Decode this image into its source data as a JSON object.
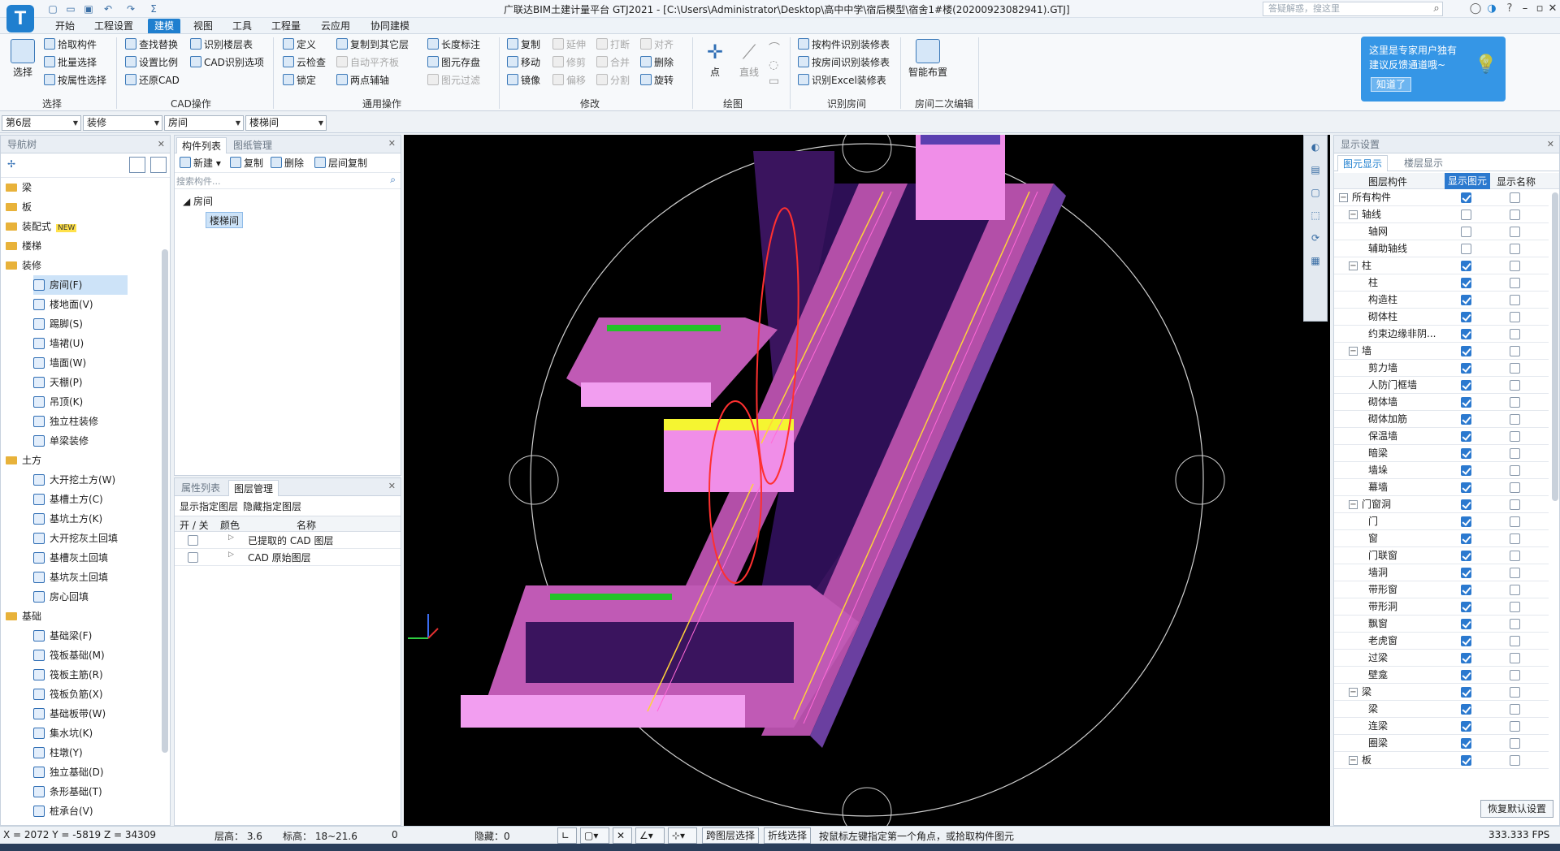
{
  "app": {
    "logo": "T",
    "title": "广联达BIM土建计量平台 GTJ2021 - [C:\\Users\\Administrator\\Desktop\\高中中学\\宿后模型\\宿舍1#楼(20200923082941).GTJ]",
    "search_placeholder": "答疑解惑，搜这里",
    "accent": "#1f7fcf"
  },
  "menu": [
    "开始",
    "工程设置",
    "建模",
    "视图",
    "工具",
    "工程量",
    "云应用",
    "协同建模"
  ],
  "menu_active": "建模",
  "ribbon": {
    "select": {
      "big": "选择",
      "items": [
        "拾取构件",
        "批量选择",
        "按属性选择"
      ],
      "label": "选择"
    },
    "cad": {
      "items": [
        "查找替换",
        "设置比例",
        "还原CAD",
        "识别楼层表",
        "CAD识别选项"
      ],
      "label": "CAD操作"
    },
    "common": {
      "items": [
        "定义",
        "云检查",
        "锁定",
        "复制到其它层",
        "自动平齐板",
        "两点辅轴",
        "长度标注",
        "图元存盘",
        "图元过滤"
      ],
      "label": "通用操作"
    },
    "modify": {
      "items": [
        "复制",
        "移动",
        "镜像",
        "延伸",
        "修剪",
        "偏移",
        "打断",
        "合并",
        "分割",
        "对齐",
        "删除",
        "旋转"
      ],
      "label": "修改"
    },
    "draw": {
      "items": [
        "点",
        "直线"
      ],
      "label": "绘图"
    },
    "room": {
      "items": [
        "按构件识别装修表",
        "按房间识别装修表",
        "识别Excel装修表"
      ],
      "label": "识别房间"
    },
    "smart": {
      "big": "智能布置",
      "label": "房间二次编辑"
    }
  },
  "toolbar": {
    "floor": "第6层",
    "type": "装修",
    "sub": "房间",
    "comp": "楼梯间"
  },
  "nav": {
    "title": "导航树",
    "items": [
      {
        "label": "梁",
        "kind": "folder"
      },
      {
        "label": "板",
        "kind": "folder"
      },
      {
        "label": "装配式",
        "kind": "folder",
        "badge": "NEW"
      },
      {
        "label": "楼梯",
        "kind": "folder"
      },
      {
        "label": "装修",
        "kind": "folder"
      },
      {
        "label": "房间(F)",
        "kind": "sub"
      },
      {
        "label": "楼地面(V)",
        "kind": "sub"
      },
      {
        "label": "踢脚(S)",
        "kind": "sub"
      },
      {
        "label": "墙裙(U)",
        "kind": "sub"
      },
      {
        "label": "墙面(W)",
        "kind": "sub"
      },
      {
        "label": "天棚(P)",
        "kind": "sub"
      },
      {
        "label": "吊顶(K)",
        "kind": "sub"
      },
      {
        "label": "独立柱装修",
        "kind": "sub"
      },
      {
        "label": "单梁装修",
        "kind": "sub"
      },
      {
        "label": "土方",
        "kind": "folder"
      },
      {
        "label": "大开挖土方(W)",
        "kind": "sub"
      },
      {
        "label": "基槽土方(C)",
        "kind": "sub"
      },
      {
        "label": "基坑土方(K)",
        "kind": "sub"
      },
      {
        "label": "大开挖灰土回填",
        "kind": "sub"
      },
      {
        "label": "基槽灰土回填",
        "kind": "sub"
      },
      {
        "label": "基坑灰土回填",
        "kind": "sub"
      },
      {
        "label": "房心回填",
        "kind": "sub"
      },
      {
        "label": "基础",
        "kind": "folder"
      },
      {
        "label": "基础梁(F)",
        "kind": "sub"
      },
      {
        "label": "筏板基础(M)",
        "kind": "sub"
      },
      {
        "label": "筏板主筋(R)",
        "kind": "sub"
      },
      {
        "label": "筏板负筋(X)",
        "kind": "sub"
      },
      {
        "label": "基础板带(W)",
        "kind": "sub"
      },
      {
        "label": "集水坑(K)",
        "kind": "sub"
      },
      {
        "label": "柱墩(Y)",
        "kind": "sub"
      },
      {
        "label": "独立基础(D)",
        "kind": "sub"
      },
      {
        "label": "条形基础(T)",
        "kind": "sub"
      },
      {
        "label": "桩承台(V)",
        "kind": "sub"
      }
    ]
  },
  "complist": {
    "tabs": [
      "构件列表",
      "图纸管理"
    ],
    "actions": [
      "新建",
      "复制",
      "删除",
      "层间复制"
    ],
    "search_placeholder": "搜索构件...",
    "group": "房间",
    "item": "楼梯间"
  },
  "layer": {
    "tabs": [
      "属性列表",
      "图层管理"
    ],
    "actions": [
      "显示指定图层",
      "隐藏指定图层"
    ],
    "headers": [
      "开 / 关",
      "颜色",
      "名称"
    ],
    "rows": [
      "已提取的 CAD 图层",
      "CAD 原始图层"
    ]
  },
  "display": {
    "title": "显示设置",
    "tabs": [
      "图元显示",
      "楼层显示"
    ],
    "headers": [
      "图层构件",
      "显示图元",
      "显示名称"
    ],
    "rows": [
      {
        "name": "所有构件",
        "lvl": 0,
        "show": true,
        "name_on": false
      },
      {
        "name": "轴线",
        "lvl": 1,
        "show": false,
        "name_on": false
      },
      {
        "name": "轴网",
        "lvl": 2,
        "show": false,
        "name_on": false
      },
      {
        "name": "辅助轴线",
        "lvl": 2,
        "show": false,
        "name_on": false
      },
      {
        "name": "柱",
        "lvl": 1,
        "show": true,
        "name_on": false
      },
      {
        "name": "柱",
        "lvl": 2,
        "show": true,
        "name_on": false
      },
      {
        "name": "构造柱",
        "lvl": 2,
        "show": true,
        "name_on": false
      },
      {
        "name": "砌体柱",
        "lvl": 2,
        "show": true,
        "name_on": false
      },
      {
        "name": "约束边缘非阴...",
        "lvl": 2,
        "show": true,
        "name_on": false
      },
      {
        "name": "墙",
        "lvl": 1,
        "show": true,
        "name_on": false
      },
      {
        "name": "剪力墙",
        "lvl": 2,
        "show": true,
        "name_on": false
      },
      {
        "name": "人防门框墙",
        "lvl": 2,
        "show": true,
        "name_on": false
      },
      {
        "name": "砌体墙",
        "lvl": 2,
        "show": true,
        "name_on": false
      },
      {
        "name": "砌体加筋",
        "lvl": 2,
        "show": true,
        "name_on": false
      },
      {
        "name": "保温墙",
        "lvl": 2,
        "show": true,
        "name_on": false
      },
      {
        "name": "暗梁",
        "lvl": 2,
        "show": true,
        "name_on": false
      },
      {
        "name": "墙垛",
        "lvl": 2,
        "show": true,
        "name_on": false
      },
      {
        "name": "幕墙",
        "lvl": 2,
        "show": true,
        "name_on": false
      },
      {
        "name": "门窗洞",
        "lvl": 1,
        "show": true,
        "name_on": false
      },
      {
        "name": "门",
        "lvl": 2,
        "show": true,
        "name_on": false
      },
      {
        "name": "窗",
        "lvl": 2,
        "show": true,
        "name_on": false
      },
      {
        "name": "门联窗",
        "lvl": 2,
        "show": true,
        "name_on": false
      },
      {
        "name": "墙洞",
        "lvl": 2,
        "show": true,
        "name_on": false
      },
      {
        "name": "带形窗",
        "lvl": 2,
        "show": true,
        "name_on": false
      },
      {
        "name": "带形洞",
        "lvl": 2,
        "show": true,
        "name_on": false
      },
      {
        "name": "飘窗",
        "lvl": 2,
        "show": true,
        "name_on": false
      },
      {
        "name": "老虎窗",
        "lvl": 2,
        "show": true,
        "name_on": false
      },
      {
        "name": "过梁",
        "lvl": 2,
        "show": true,
        "name_on": false
      },
      {
        "name": "壁龛",
        "lvl": 2,
        "show": true,
        "name_on": false
      },
      {
        "name": "梁",
        "lvl": 1,
        "show": true,
        "name_on": false
      },
      {
        "name": "梁",
        "lvl": 2,
        "show": true,
        "name_on": false
      },
      {
        "name": "连梁",
        "lvl": 2,
        "show": true,
        "name_on": false
      },
      {
        "name": "圈梁",
        "lvl": 2,
        "show": true,
        "name_on": false
      },
      {
        "name": "板",
        "lvl": 1,
        "show": true,
        "name_on": false
      }
    ],
    "restore": "恢复默认设置"
  },
  "tip": {
    "line1": "这里是专家用户独有",
    "line2": "建议反馈通道哦~",
    "button": "知道了"
  },
  "status": {
    "coords": "X = 2072 Y = -5819 Z = 34309",
    "floor_h": "层高： 3.6",
    "elev": "标高： 18~21.6",
    "zero": "0",
    "hidden": "隐藏：0",
    "btn1": "跨图层选择",
    "btn2": "折线选择",
    "hint": "按鼠标左键指定第一个角点，或拾取构件图元",
    "fps": "333.333 FPS"
  }
}
